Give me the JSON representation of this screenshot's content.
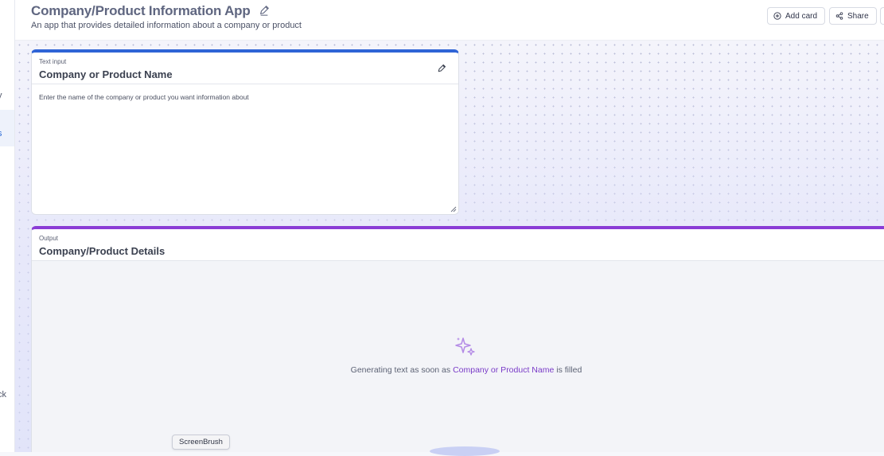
{
  "sidebar": {
    "fragments": [
      "t",
      "y",
      "s",
      "ck"
    ]
  },
  "header": {
    "title": "Company/Product Information App",
    "subtitle": "An app that provides detailed information about a company or product",
    "add_card_label": "Add card",
    "share_label": "Share"
  },
  "cards": {
    "input": {
      "type_label": "Text input",
      "title": "Company or Product Name",
      "placeholder": "Enter the name of the company or product you want information about",
      "accent": "#2f64d6"
    },
    "output": {
      "type_label": "Output",
      "title": "Company/Product Details",
      "message_prefix": "Generating text as soon as",
      "message_field": "Company or Product Name",
      "message_suffix": "is filled",
      "accent": "#8a3cd6",
      "icon": "sparkle-icon"
    }
  },
  "overlay": {
    "screenbrush_label": "ScreenBrush"
  }
}
